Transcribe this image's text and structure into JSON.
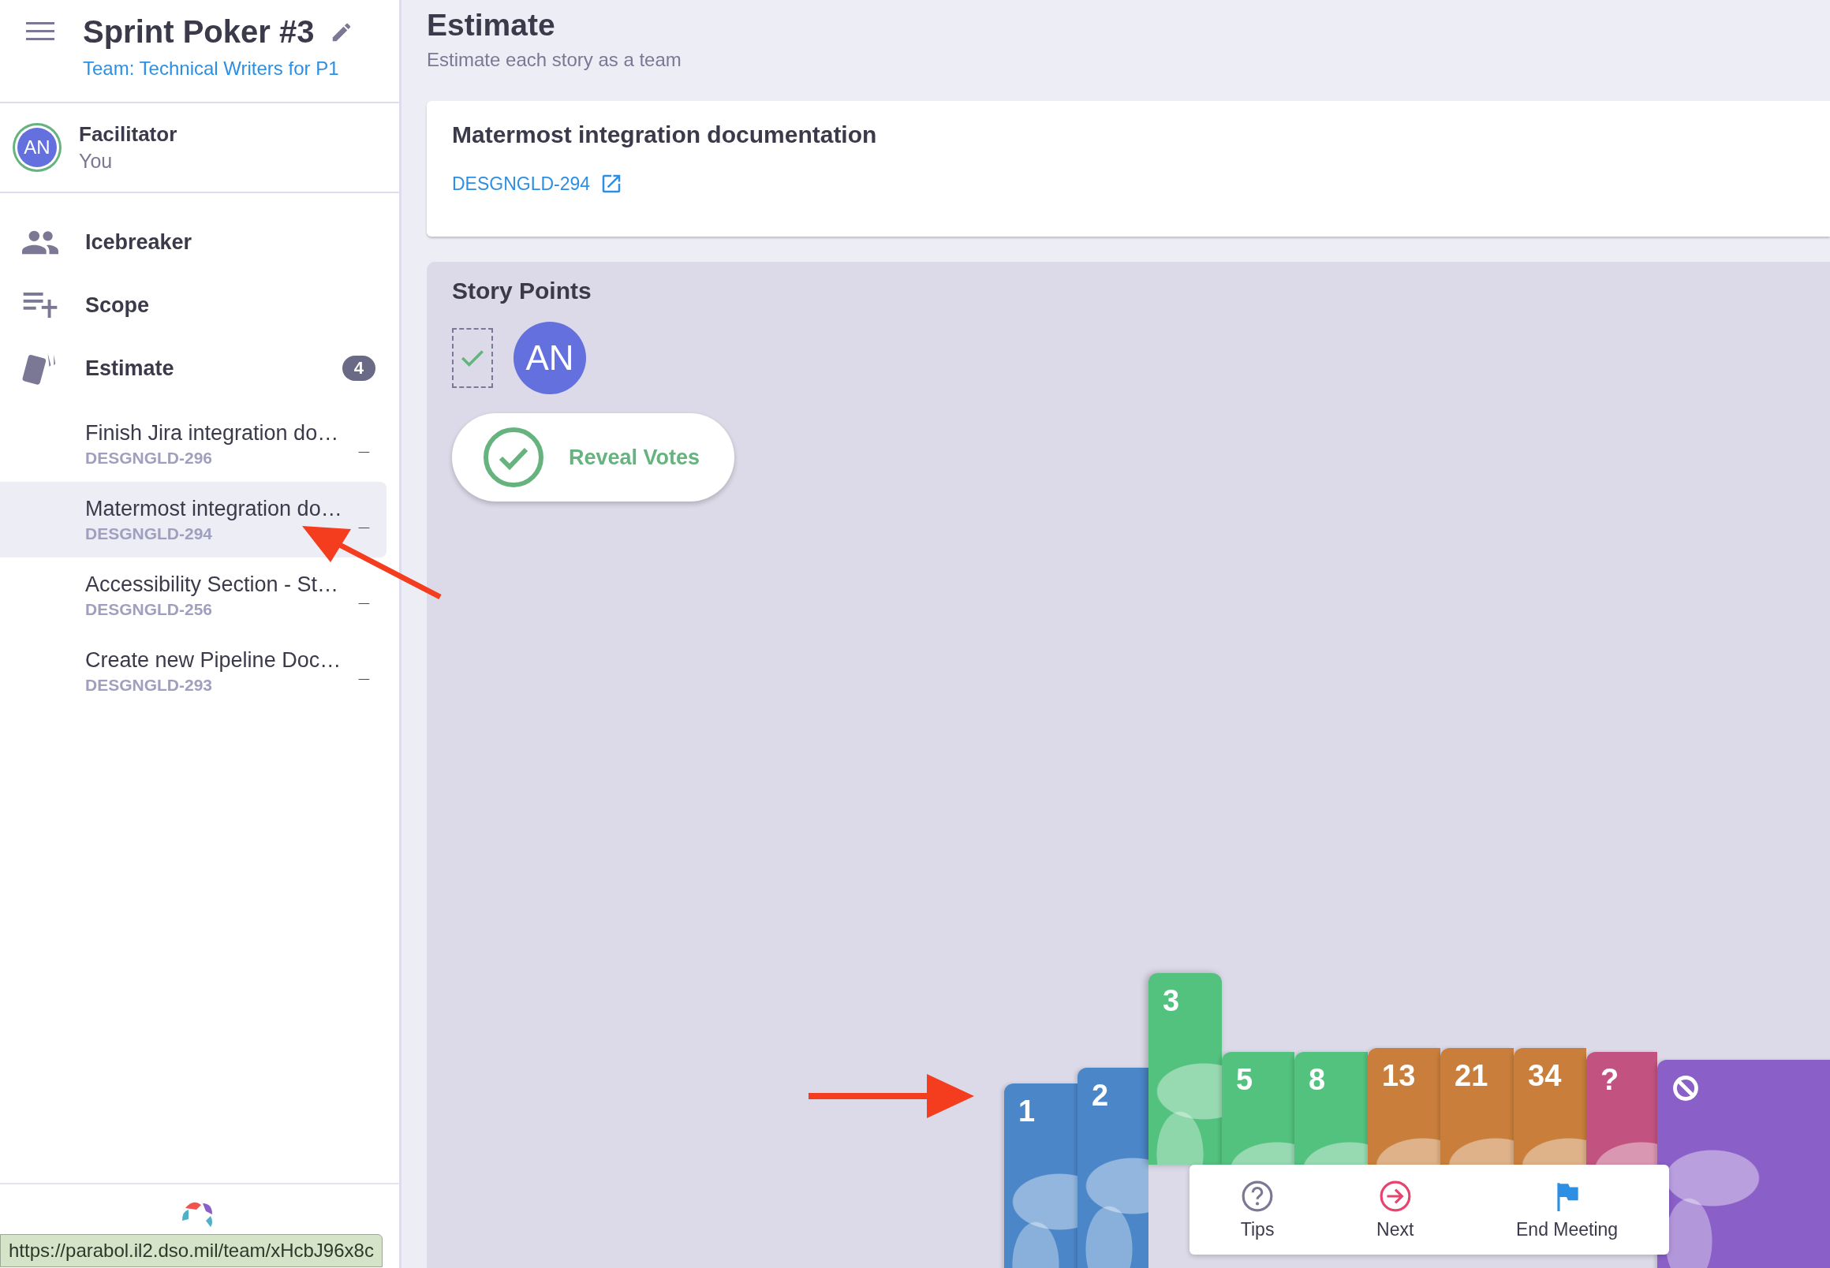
{
  "sidebar": {
    "title": "Sprint Poker #3",
    "team": "Team: Technical Writers for P1",
    "facilitator": {
      "role": "Facilitator",
      "name": "You",
      "initials": "AN"
    },
    "nav": [
      {
        "label": "Icebreaker",
        "kind": "people"
      },
      {
        "label": "Scope",
        "kind": "scope"
      },
      {
        "label": "Estimate",
        "kind": "cards",
        "badge": "4"
      }
    ],
    "stories": [
      {
        "title": "Finish Jira integration do…",
        "key": "DESGNGLD-296",
        "estimate": "_",
        "selected": false
      },
      {
        "title": "Matermost integration do…",
        "key": "DESGNGLD-294",
        "estimate": "_",
        "selected": true
      },
      {
        "title": "Accessibility Section - St…",
        "key": "DESGNGLD-256",
        "estimate": "_",
        "selected": false
      },
      {
        "title": "Create new Pipeline Doc…",
        "key": "DESGNGLD-293",
        "estimate": "_",
        "selected": false
      }
    ]
  },
  "main": {
    "title": "Estimate",
    "subtitle": "Estimate each story as a team",
    "story": {
      "title": "Matermost integration documentation",
      "key": "DESGNGLD-294"
    },
    "story_points": {
      "title": "Story Points",
      "voters": [
        {
          "initials": "AN",
          "voted": true
        }
      ],
      "reveal_button": "Reveal Votes",
      "cards": [
        {
          "kind": "number",
          "label": "1",
          "color": "#4a86c8",
          "selected": false
        },
        {
          "kind": "number",
          "label": "2",
          "color": "#4a86c8",
          "selected": false
        },
        {
          "kind": "number",
          "label": "3",
          "color": "#52c27e",
          "selected": true
        },
        {
          "kind": "number",
          "label": "5",
          "color": "#52c27e",
          "selected": false
        },
        {
          "kind": "number",
          "label": "8",
          "color": "#52c27e",
          "selected": false
        },
        {
          "kind": "number",
          "label": "13",
          "color": "#c97f3b",
          "selected": false
        },
        {
          "kind": "number",
          "label": "21",
          "color": "#c97f3b",
          "selected": false
        },
        {
          "kind": "number",
          "label": "34",
          "color": "#c97f3b",
          "selected": false
        },
        {
          "kind": "number",
          "label": "?",
          "color": "#c2527f",
          "selected": false
        },
        {
          "kind": "pass",
          "color": "#8a5fc8",
          "selected": false
        }
      ]
    }
  },
  "bottom_bar": [
    {
      "kind": "tips",
      "label": "Tips"
    },
    {
      "kind": "next",
      "label": "Next"
    },
    {
      "kind": "end",
      "label": "End Meeting"
    }
  ],
  "status_bar_url": "https://parabol.il2.dso.mil/team/xHcbJ96x8c"
}
